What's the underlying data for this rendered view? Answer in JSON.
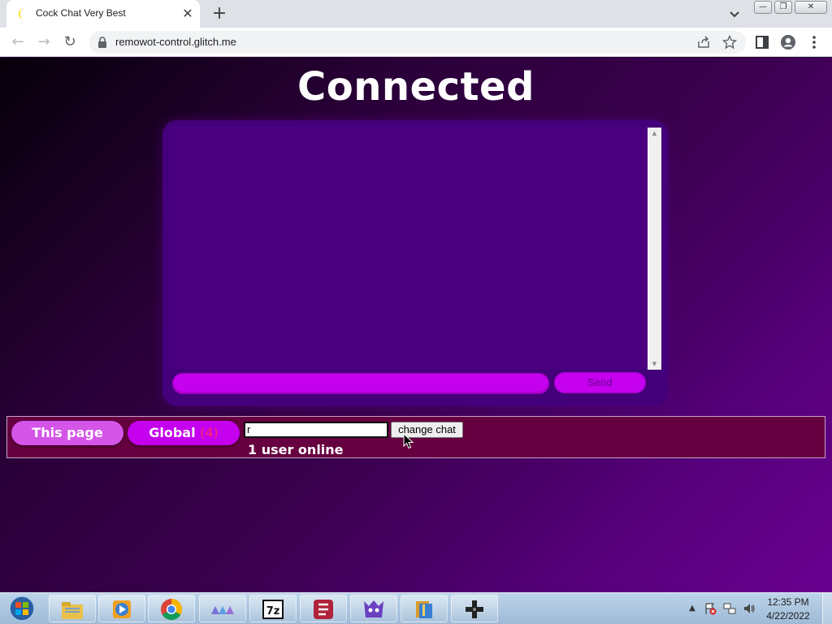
{
  "browser": {
    "tab_title": "Cock Chat Very Best",
    "tab_close": "✕",
    "new_tab": "+",
    "url": "remowot-control.glitch.me",
    "window_controls": {
      "minimize": "—",
      "restore": "❐",
      "close": "✕"
    }
  },
  "page": {
    "heading": "Connected",
    "send_label": "Send",
    "message_value": "",
    "tabs": {
      "this_page": "This page",
      "global": "Global",
      "global_badge": "(4)"
    },
    "chat_name_value": "r",
    "change_chat_label": "change chat",
    "online_status": "1 user online"
  },
  "taskbar": {
    "apps": [
      "windows-explorer",
      "media-player",
      "chrome",
      "app-triangles",
      "7-zip",
      "filezilla",
      "app-character",
      "archive-app",
      "gamepad-app"
    ],
    "time": "12:35 PM",
    "date": "4/22/2022"
  },
  "colors": {
    "accent": "#c400ee",
    "bar": "#660040",
    "chat_card": "#44007a"
  }
}
